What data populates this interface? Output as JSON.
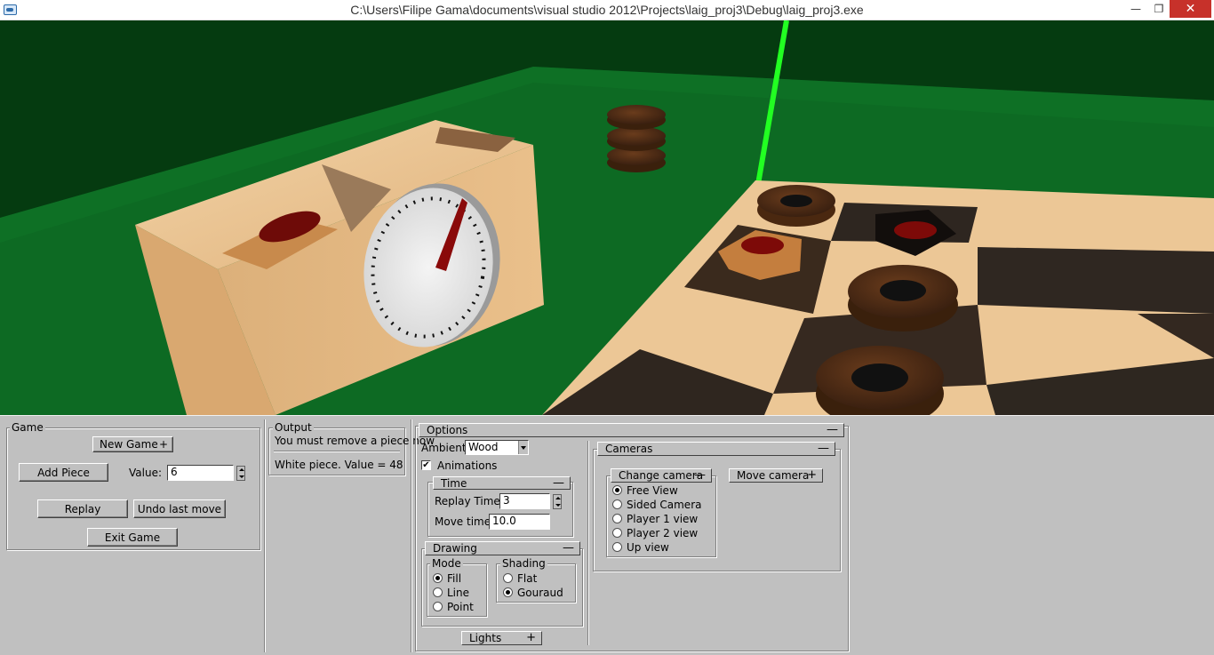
{
  "window": {
    "title": "C:\\Users\\Filipe Gama\\documents\\visual studio 2012\\Projects\\laig_proj3\\Debug\\laig_proj3.exe",
    "minimize_glyph": "—",
    "restore_glyph": "❐",
    "close_glyph": "✕"
  },
  "game": {
    "label": "Game",
    "new_game_label": "New Game",
    "new_game_sign": "+",
    "add_piece_label": "Add Piece",
    "value_label": "Value:",
    "value": "6",
    "replay_label": "Replay",
    "undo_label": "Undo last move",
    "exit_label": "Exit Game"
  },
  "output": {
    "label": "Output",
    "message": "You must remove a piece now",
    "piece_info": "White piece. Value = 48"
  },
  "options": {
    "label": "Options",
    "sign": "—",
    "ambient_label": "Ambient",
    "ambient_value": "Wood",
    "animations_label": "Animations",
    "animations_checked": "✔",
    "time": {
      "label": "Time",
      "sign": "—",
      "replay_time_label": "Replay Time",
      "replay_time_value": "3",
      "move_time_label": "Move time",
      "move_time_value": "10.0"
    },
    "drawing": {
      "label": "Drawing",
      "sign": "—",
      "mode_label": "Mode",
      "modes": [
        "Fill",
        "Line",
        "Point"
      ],
      "mode_selected": "Fill",
      "shading_label": "Shading",
      "shadings": [
        "Flat",
        "Gouraud"
      ],
      "shading_selected": "Gouraud"
    },
    "lights_label": "Lights",
    "lights_sign": "+"
  },
  "cameras": {
    "label": "Cameras",
    "sign": "—",
    "change_camera_label": "Change camera",
    "change_camera_sign": "—",
    "options": [
      "Free View",
      "Sided Camera",
      "Player 1 view",
      "Player 2 view",
      "Up view"
    ],
    "selected": "Free View",
    "move_camera_label": "Move camera",
    "move_camera_sign": "+"
  },
  "colors": {
    "panel_bg": "#c0c0c0",
    "table_green": "#0d6a23",
    "wall_green": "#053b10",
    "light_wood": "#ecc796",
    "dark_wood": "#3a2a1d",
    "piece_red": "#7d0a08",
    "axis_green": "#22ff22",
    "close_red": "#c7312a"
  }
}
